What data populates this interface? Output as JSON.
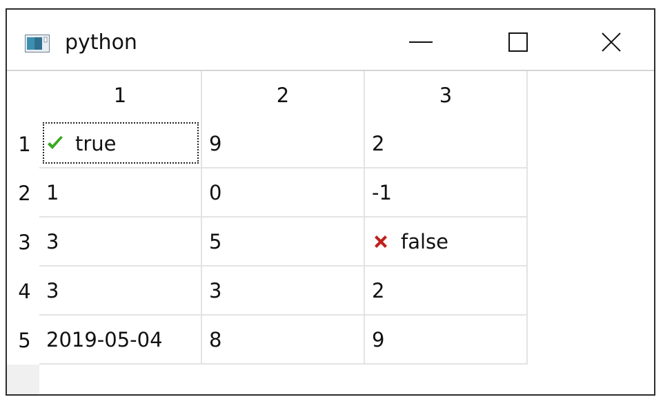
{
  "window": {
    "title": "python"
  },
  "table": {
    "column_headers": [
      "1",
      "2",
      "3"
    ],
    "row_headers": [
      "1",
      "2",
      "3",
      "4",
      "5"
    ],
    "rows": [
      [
        {
          "text": "true",
          "icon": "check-icon"
        },
        {
          "text": "9"
        },
        {
          "text": "2"
        }
      ],
      [
        {
          "text": "1"
        },
        {
          "text": "0"
        },
        {
          "text": "-1"
        }
      ],
      [
        {
          "text": "3"
        },
        {
          "text": "5"
        },
        {
          "text": "false",
          "icon": "cross-icon"
        }
      ],
      [
        {
          "text": "3"
        },
        {
          "text": "3"
        },
        {
          "text": "2"
        }
      ],
      [
        {
          "text": "2019-05-04"
        },
        {
          "text": "8"
        },
        {
          "text": "9"
        }
      ]
    ]
  },
  "colors": {
    "check": "#3aa81f",
    "cross": "#c0211d",
    "grid": "#e3e3e3"
  }
}
